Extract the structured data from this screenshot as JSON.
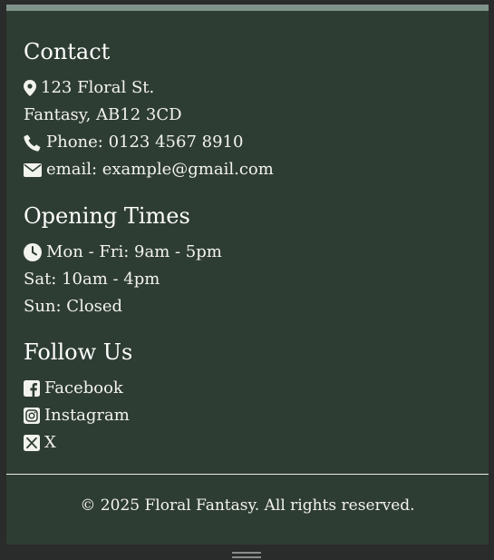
{
  "contact": {
    "heading": "Contact",
    "address_line1": "123 Floral St.",
    "address_line2": "Fantasy, AB12 3CD",
    "phone": "Phone: 0123 4567 8910",
    "email": "email: example@gmail.com"
  },
  "opening_times": {
    "heading": "Opening Times",
    "weekdays": "Mon - Fri: 9am - 5pm",
    "saturday": "Sat: 10am - 4pm",
    "sunday": "Sun: Closed"
  },
  "follow": {
    "heading": "Follow Us",
    "links": [
      {
        "label": "Facebook",
        "icon": "facebook-icon"
      },
      {
        "label": "Instagram",
        "icon": "instagram-icon"
      },
      {
        "label": "X",
        "icon": "x-icon"
      }
    ]
  },
  "copyright": "© 2025 Floral Fantasy. All rights reserved.",
  "colors": {
    "footer_bg": "#2e3d33",
    "top_strip": "#7f938a",
    "text": "#f3f3ee",
    "page_bg": "#2a2b2b"
  }
}
